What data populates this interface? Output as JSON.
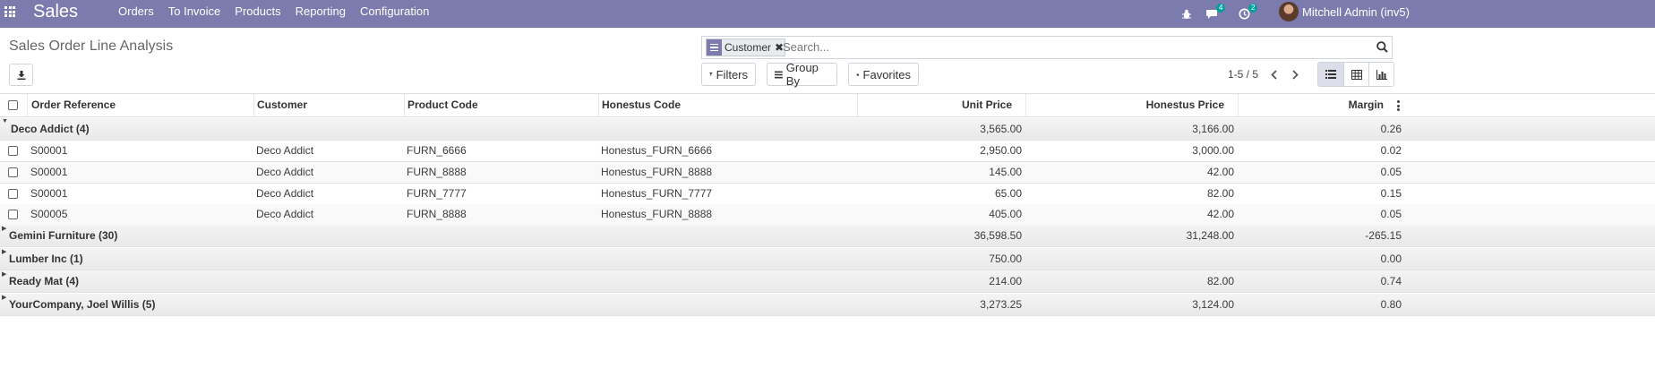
{
  "navbar": {
    "brand": "Sales",
    "menu": [
      "Orders",
      "To Invoice",
      "Products",
      "Reporting",
      "Configuration"
    ],
    "messages_badge": "4",
    "activities_badge": "2",
    "user": "Mitchell Admin (inv5)"
  },
  "page": {
    "title": "Sales Order Line Analysis"
  },
  "search": {
    "facet_label": "Customer",
    "placeholder": "Search..."
  },
  "toolbar": {
    "filters": "Filters",
    "group_by": "Group By",
    "favorites": "Favorites",
    "pager": "1-5 / 5"
  },
  "table": {
    "columns": {
      "order_ref": "Order Reference",
      "customer": "Customer",
      "product_code": "Product Code",
      "honestus_code": "Honestus Code",
      "unit_price": "Unit Price",
      "honestus_price": "Honestus Price",
      "margin": "Margin"
    },
    "groups": [
      {
        "name": "Deco Addict (4)",
        "unit_price": "3,565.00",
        "honestus_price": "3,166.00",
        "margin": "0.26",
        "expanded": true,
        "rows": [
          {
            "order_ref": "S00001",
            "customer": "Deco Addict",
            "product_code": "FURN_6666",
            "honestus_code": "Honestus_FURN_6666",
            "unit_price": "2,950.00",
            "honestus_price": "3,000.00",
            "margin": "0.02"
          },
          {
            "order_ref": "S00001",
            "customer": "Deco Addict",
            "product_code": "FURN_8888",
            "honestus_code": "Honestus_FURN_8888",
            "unit_price": "145.00",
            "honestus_price": "42.00",
            "margin": "0.05"
          },
          {
            "order_ref": "S00001",
            "customer": "Deco Addict",
            "product_code": "FURN_7777",
            "honestus_code": "Honestus_FURN_7777",
            "unit_price": "65.00",
            "honestus_price": "82.00",
            "margin": "0.15"
          },
          {
            "order_ref": "S00005",
            "customer": "Deco Addict",
            "product_code": "FURN_8888",
            "honestus_code": "Honestus_FURN_8888",
            "unit_price": "405.00",
            "honestus_price": "42.00",
            "margin": "0.05"
          }
        ]
      },
      {
        "name": "Gemini Furniture (30)",
        "unit_price": "36,598.50",
        "honestus_price": "31,248.00",
        "margin": "-265.15",
        "expanded": false
      },
      {
        "name": "Lumber Inc (1)",
        "unit_price": "750.00",
        "honestus_price": "",
        "margin": "0.00",
        "expanded": false
      },
      {
        "name": "Ready Mat (4)",
        "unit_price": "214.00",
        "honestus_price": "82.00",
        "margin": "0.74",
        "expanded": false
      },
      {
        "name": "YourCompany, Joel Willis (5)",
        "unit_price": "3,273.25",
        "honestus_price": "3,124.00",
        "margin": "0.80",
        "expanded": false
      }
    ]
  }
}
